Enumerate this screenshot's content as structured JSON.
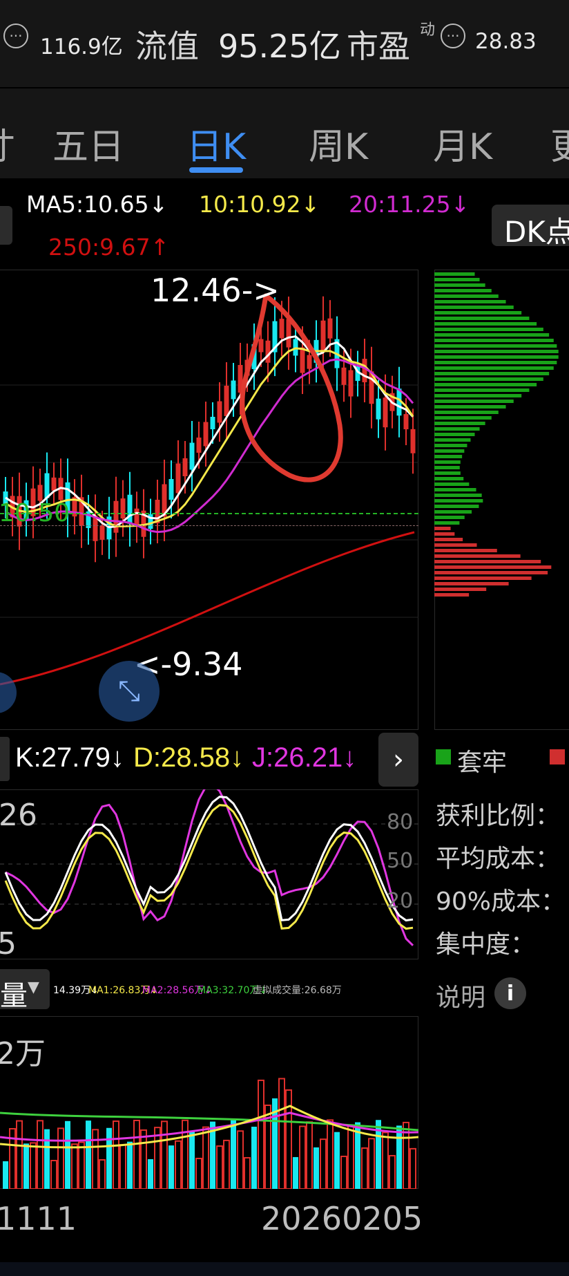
{
  "header": {
    "metric1_value": "116.9亿",
    "metric2_label": "流值",
    "metric2_value": "95.25亿",
    "metric3_label": "市盈",
    "metric3_superscript": "动",
    "metric3_value": "28.83",
    "more_icon": "ellipsis-circle-icon"
  },
  "tabs": [
    {
      "label": "寸",
      "active": false
    },
    {
      "label": "五日",
      "active": false
    },
    {
      "label": "日K",
      "active": true
    },
    {
      "label": "周K",
      "active": false
    },
    {
      "label": "月K",
      "active": false
    },
    {
      "label": "更",
      "active": false
    }
  ],
  "ma_legend": {
    "ma5": "MA5:10.65↓",
    "ma10": "10:10.92↓",
    "ma20": "20:11.25↓",
    "ma250": "250:9.67↑",
    "dk_button": "DK点",
    "colors": {
      "ma5": "#ffffff",
      "ma10": "#f5e94a",
      "ma20": "#d02bd0",
      "ma250": "#d01010"
    }
  },
  "kline": {
    "high_annotation": "12.46->",
    "low_annotation": "<-9.34",
    "price_line_label": "10.50",
    "colors": {
      "up": "#e0302c",
      "down": "#19e8f0",
      "price_line": "#25b325"
    },
    "expand_icon": "expand-arrows-icon"
  },
  "chip_distribution": {
    "legend_trapped": "套牢",
    "legend_colors": {
      "trapped": "#19a319",
      "profit": "#d02f2f"
    },
    "labels": [
      "获利比例：",
      "平均成本：",
      "90%成本：",
      "集中度："
    ],
    "explain_label": "说明",
    "info_icon": "info-icon"
  },
  "kdj": {
    "k": "K:27.79↓",
    "d": "D:28.58↓",
    "j": "J:26.21↓",
    "left_top": "26",
    "left_bottom": "5",
    "axis": [
      "80",
      "50",
      "20"
    ],
    "next_icon": "chevron-right-icon"
  },
  "volume": {
    "selector_label": "量",
    "legend": {
      "vol": "14.39万↓",
      "ma1": "MA1:26.83万↓",
      "ma2": "MA2:28.56万↓",
      "ma3": "MA3:32.70万↓",
      "virtual": "虚拟成交量:26.68万"
    },
    "max_label": "2万",
    "start_date": "1111",
    "end_date": "20260205"
  }
}
